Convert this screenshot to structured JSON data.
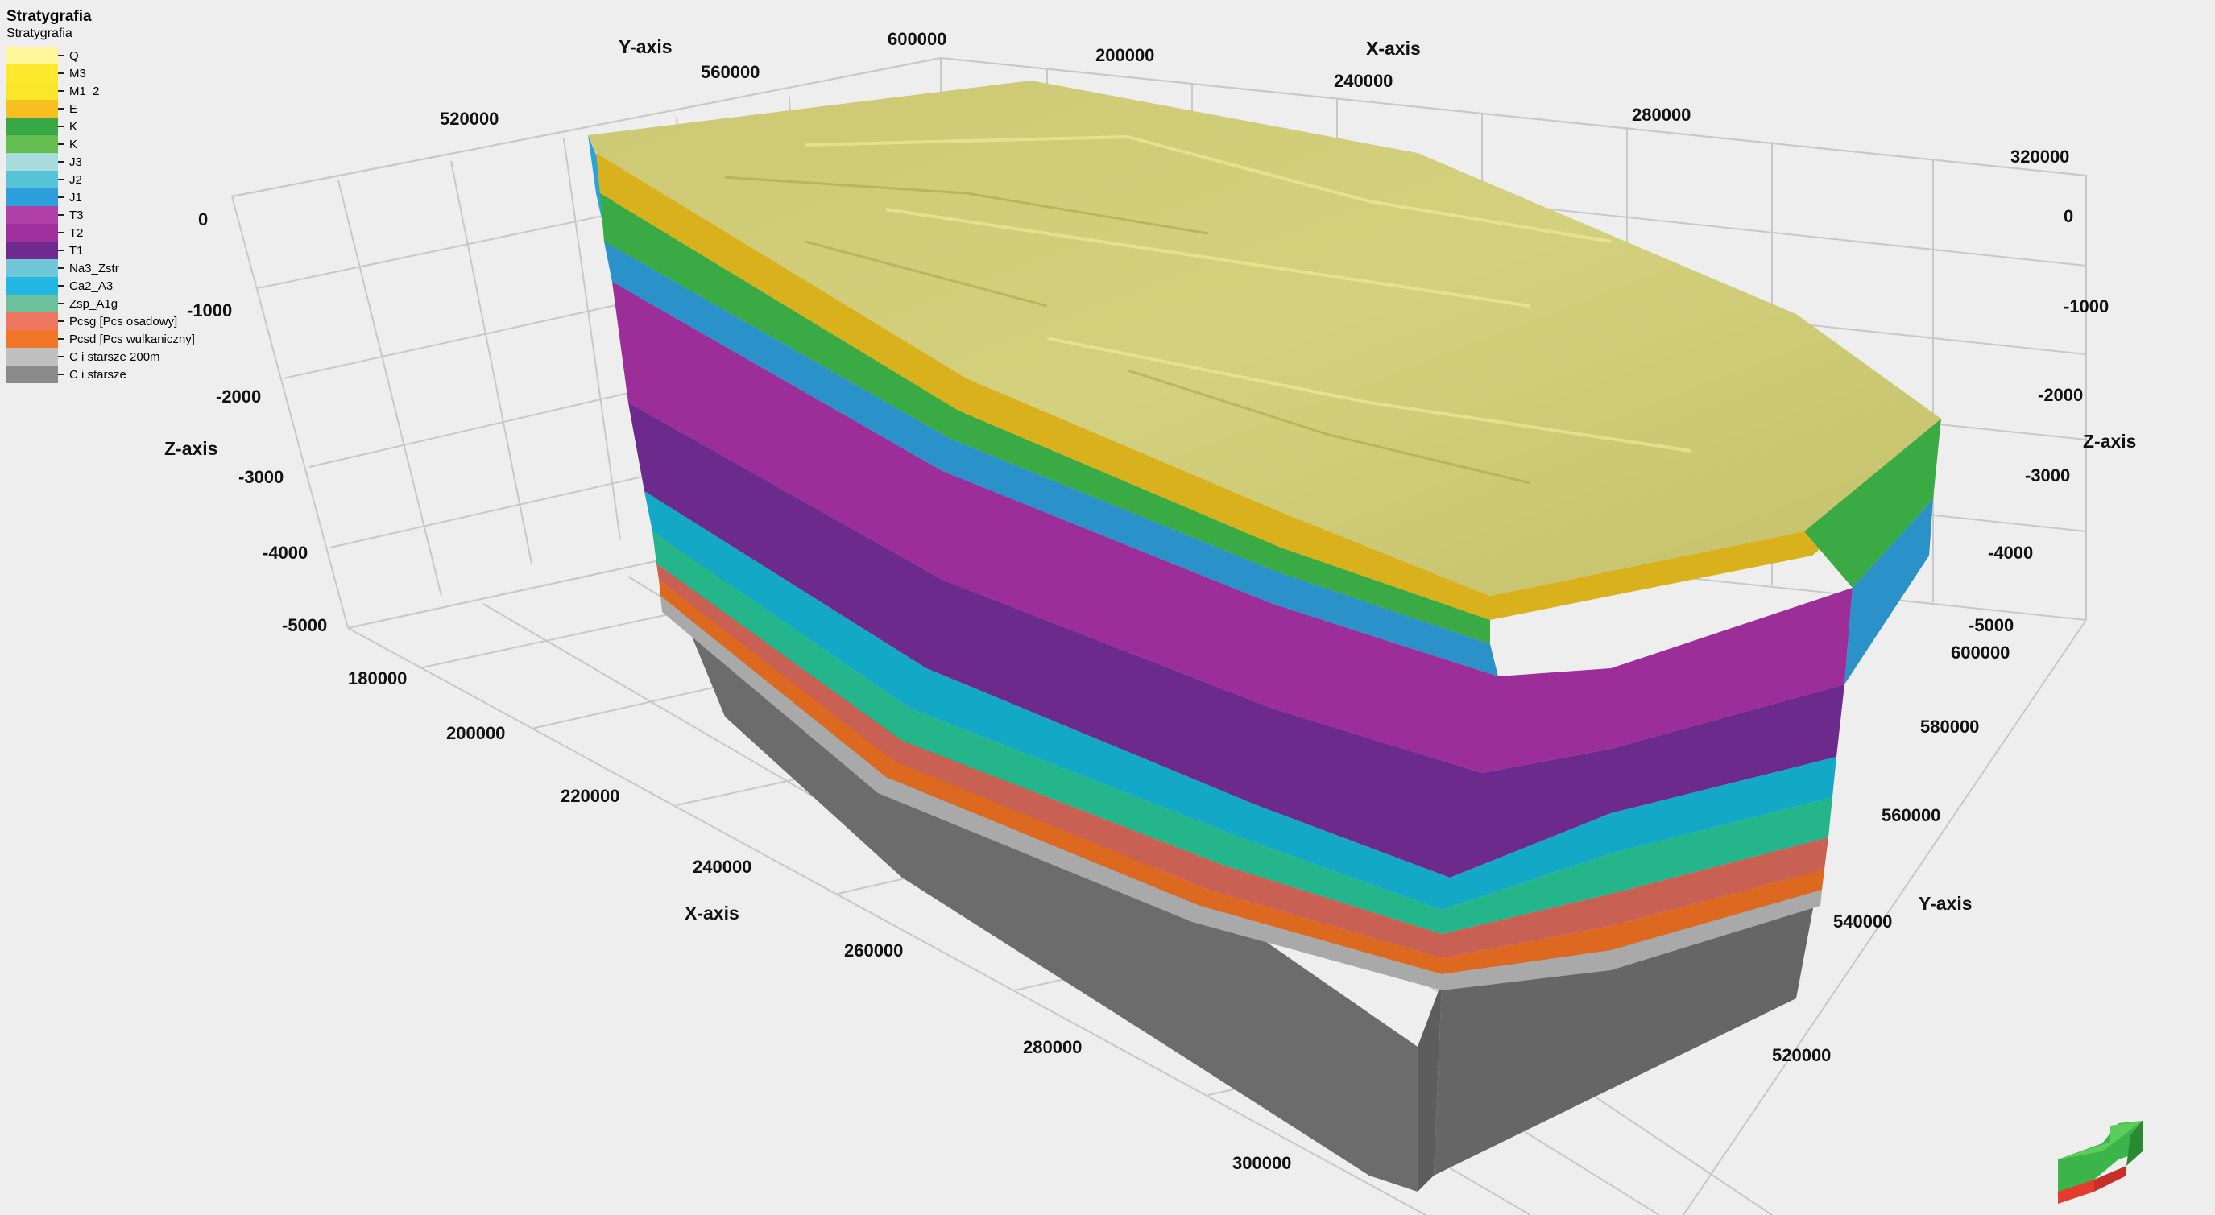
{
  "legend": {
    "title": "Stratygrafia",
    "subtitle": "Stratygrafia",
    "items": [
      {
        "label": "Q",
        "color": "#fff59a"
      },
      {
        "label": "M3",
        "color": "#fde92e"
      },
      {
        "label": "M1_2",
        "color": "#fbe72a"
      },
      {
        "label": "E",
        "color": "#f7bf22"
      },
      {
        "label": "K",
        "color": "#37a845"
      },
      {
        "label": "K",
        "color": "#63bd4f"
      },
      {
        "label": "J3",
        "color": "#a9dcdc"
      },
      {
        "label": "J2",
        "color": "#56c3d6"
      },
      {
        "label": "J1",
        "color": "#2d9fdb"
      },
      {
        "label": "T3",
        "color": "#b13fa8"
      },
      {
        "label": "T2",
        "color": "#a0309e"
      },
      {
        "label": "T1",
        "color": "#6e2a8f"
      },
      {
        "label": "Na3_Zstr",
        "color": "#70c6d6"
      },
      {
        "label": "Ca2_A3",
        "color": "#22b7e0"
      },
      {
        "label": "Zsp_A1g",
        "color": "#6cc09c"
      },
      {
        "label": "Pcsg [Pcs osadowy]",
        "color": "#ef7761"
      },
      {
        "label": "Pcsd [Pcs wulkaniczny]",
        "color": "#f17628"
      },
      {
        "label": "C i starsze 200m",
        "color": "#c0c0c0"
      },
      {
        "label": "C i starsze",
        "color": "#8b8b8b"
      }
    ]
  },
  "axes": {
    "y_axis_title": "Y-axis",
    "x_axis_title": "X-axis",
    "z_axis_title": "Z-axis",
    "y_top_ticks": [
      "520000",
      "560000",
      "600000"
    ],
    "x_top_ticks": [
      "200000",
      "240000",
      "280000",
      "320000"
    ],
    "z_left_ticks": [
      "0",
      "-1000",
      "-2000",
      "-3000",
      "-4000",
      "-5000"
    ],
    "z_right_ticks": [
      "0",
      "-1000",
      "-2000",
      "-3000",
      "-4000",
      "-5000"
    ],
    "x_bottom_ticks": [
      "180000",
      "200000",
      "220000",
      "240000",
      "260000",
      "280000",
      "300000"
    ],
    "y_right_ticks": [
      "600000",
      "580000",
      "560000",
      "540000",
      "520000"
    ]
  },
  "orientation_widget": {
    "icon": "orientation-arrow-icon",
    "colors": [
      "#3bb54a",
      "#e53a2e"
    ]
  },
  "surface_color": "#c9c56e"
}
